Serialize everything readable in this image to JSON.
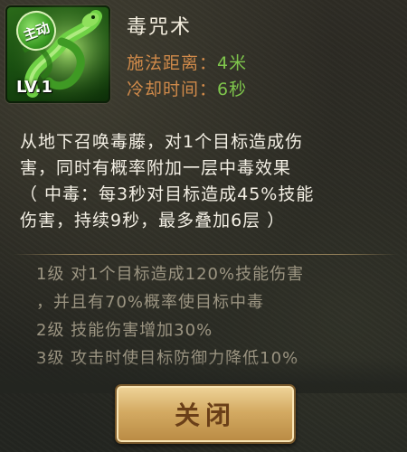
{
  "skill": {
    "name": "毒咒术",
    "badge": "主动",
    "level": "LV.1",
    "range_label": "施法距离：",
    "range_value": "4米",
    "cooldown_label": "冷却时间：",
    "cooldown_value": "6秒",
    "icon": "poison-serpent-icon"
  },
  "description": {
    "lines": [
      "从地下召唤毒藤，对1个目标造成伤",
      "害，同时有概率附加一层中毒效果",
      "（ 中毒：每3秒对目标造成45%技能",
      "伤害，持续9秒，最多叠加6层 ）"
    ]
  },
  "levels": {
    "lines": [
      "1级 对1个目标造成120%技能伤害",
      "，并且有70%概率使目标中毒",
      "2级 技能伤害增加30%",
      "3级 攻击时使目标防御力降低10%"
    ]
  },
  "buttons": {
    "close": "关闭"
  },
  "colors": {
    "label": "#d08a4a",
    "value": "#7fc64c",
    "button": "#d4ab63"
  }
}
